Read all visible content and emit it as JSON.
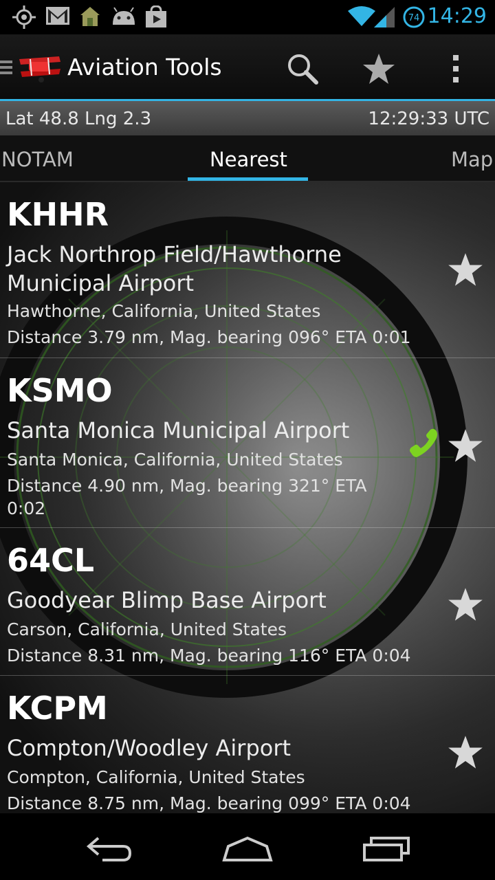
{
  "status_bar": {
    "time": "14:29",
    "battery_level": "74",
    "icons": [
      "gps-icon",
      "gmail-icon",
      "home-icon",
      "android-icon",
      "store-icon",
      "wifi-icon",
      "signal-icon",
      "battery-icon"
    ]
  },
  "action_bar": {
    "title": "Aviation Tools",
    "actions": [
      "search-icon",
      "star-icon",
      "overflow-menu-icon"
    ]
  },
  "info_bar": {
    "position": "Lat 48.8 Lng 2.3",
    "utc_time": "12:29:33 UTC"
  },
  "tabs": [
    {
      "label": "NOTAM",
      "active": false
    },
    {
      "label": "Nearest",
      "active": true
    },
    {
      "label": "Map",
      "active": false
    }
  ],
  "airports": [
    {
      "code": "KHHR",
      "name": "Jack Northrop Field/Hawthorne Municipal Airport",
      "location": "Hawthorne, California, United States",
      "details": "Distance 3.79 nm, Mag. bearing 096° ETA 0:01",
      "has_phone": false
    },
    {
      "code": "KSMO",
      "name": "Santa Monica Municipal Airport",
      "location": "Santa Monica, California, United States",
      "details": "Distance 4.90 nm, Mag. bearing 321° ETA 0:02",
      "has_phone": true
    },
    {
      "code": "64CL",
      "name": "Goodyear Blimp Base Airport",
      "location": "Carson, California, United States",
      "details": "Distance 8.31 nm, Mag. bearing 116° ETA 0:04",
      "has_phone": false
    },
    {
      "code": "KCPM",
      "name": "Compton/Woodley Airport",
      "location": "Compton, California, United States",
      "details": "Distance 8.75 nm, Mag. bearing 099° ETA 0:04",
      "has_phone": false
    }
  ],
  "nav_bar": [
    "back-icon",
    "home-icon",
    "recent-apps-icon"
  ],
  "colors": {
    "accent": "#33b5e5",
    "phone": "#7dd321",
    "star": "#d8d8d8"
  }
}
